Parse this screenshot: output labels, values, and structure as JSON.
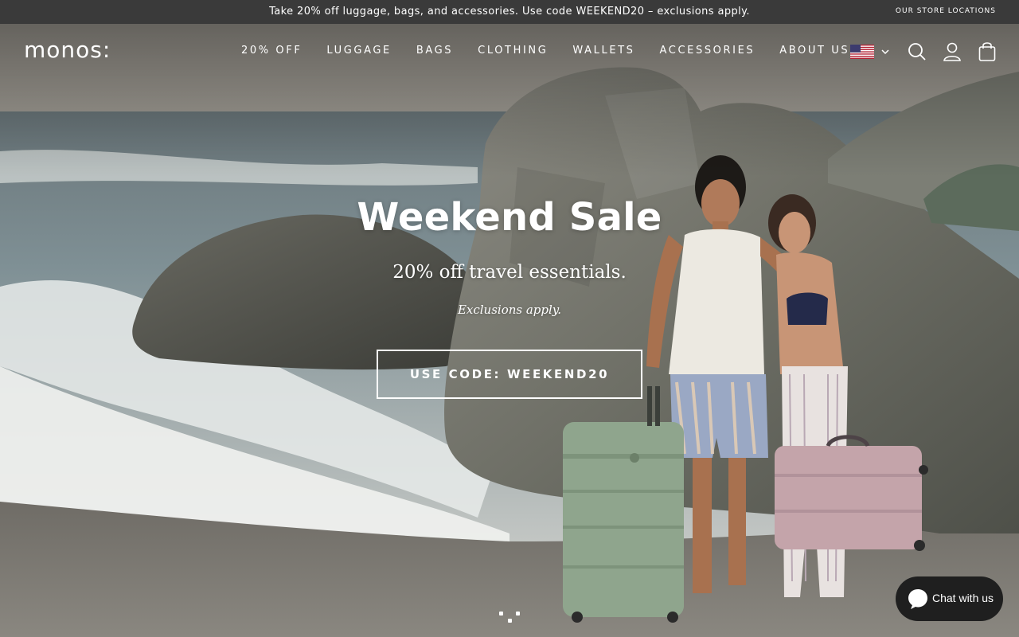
{
  "announcement": {
    "text": "Take 20% off luggage, bags, and accessories. Use code WEEKEND20 – exclusions apply.",
    "store_locations": "OUR STORE LOCATIONS"
  },
  "header": {
    "logo_text": "monos:",
    "nav": [
      {
        "label": "20% OFF"
      },
      {
        "label": "LUGGAGE"
      },
      {
        "label": "BAGS"
      },
      {
        "label": "CLOTHING"
      },
      {
        "label": "WALLETS"
      },
      {
        "label": "ACCESSORIES"
      },
      {
        "label": "ABOUT US"
      }
    ],
    "icons": [
      "us-flag-icon",
      "chevron-down-icon",
      "search-icon",
      "account-icon",
      "cart-icon"
    ]
  },
  "hero": {
    "title": "Weekend Sale",
    "subtitle": "20% off travel essentials.",
    "note": "Exclusions apply.",
    "cta_label": "USE CODE: WEEKEND20"
  },
  "chat": {
    "label": "Chat with us"
  },
  "colors": {
    "announcement_bg": "#3a3a3a",
    "text_light": "#ffffff",
    "chat_bg": "#1f1f1f"
  }
}
